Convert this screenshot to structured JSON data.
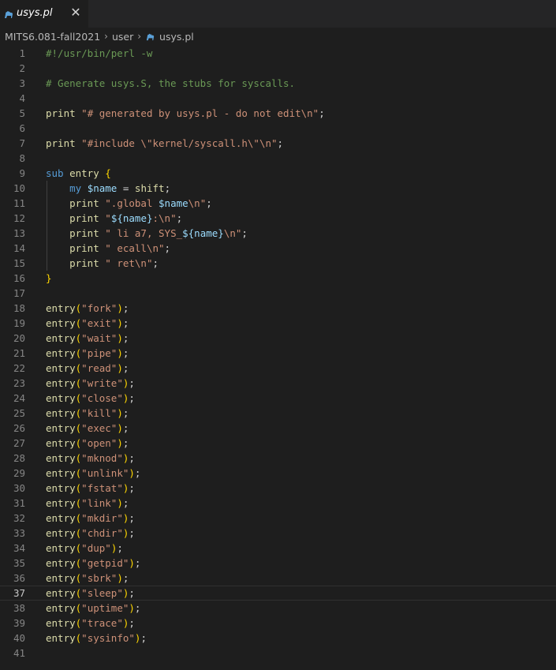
{
  "tab": {
    "title": "usys.pl",
    "close_glyph": "✕",
    "icon": "perl-camel-icon"
  },
  "breadcrumb": {
    "folder1": "MITS6.081-fall2021",
    "folder2": "user",
    "file": "usys.pl"
  },
  "editor": {
    "current_line": 37,
    "lines": [
      {
        "n": "1",
        "tokens": [
          {
            "t": "#!/usr/bin/perl -w",
            "c": "comment"
          }
        ]
      },
      {
        "n": "2",
        "tokens": []
      },
      {
        "n": "3",
        "tokens": [
          {
            "t": "# Generate usys.S, the stubs for syscalls.",
            "c": "comment"
          }
        ]
      },
      {
        "n": "4",
        "tokens": []
      },
      {
        "n": "5",
        "tokens": [
          {
            "t": "print",
            "c": "func"
          },
          {
            "t": " ",
            "c": "plain"
          },
          {
            "t": "\"# generated by usys.pl - do not edit\\n\"",
            "c": "string"
          },
          {
            "t": ";",
            "c": "plain"
          }
        ]
      },
      {
        "n": "6",
        "tokens": []
      },
      {
        "n": "7",
        "tokens": [
          {
            "t": "print",
            "c": "func"
          },
          {
            "t": " ",
            "c": "plain"
          },
          {
            "t": "\"#include \\\"kernel/syscall.h\\\"\\n\"",
            "c": "string"
          },
          {
            "t": ";",
            "c": "plain"
          }
        ]
      },
      {
        "n": "8",
        "tokens": []
      },
      {
        "n": "9",
        "tokens": [
          {
            "t": "sub",
            "c": "keyword"
          },
          {
            "t": " ",
            "c": "plain"
          },
          {
            "t": "entry",
            "c": "func"
          },
          {
            "t": " ",
            "c": "plain"
          },
          {
            "t": "{",
            "c": "brace"
          }
        ]
      },
      {
        "n": "10",
        "tokens": [
          {
            "t": "    ",
            "c": "plain"
          },
          {
            "t": "my",
            "c": "keyword"
          },
          {
            "t": " ",
            "c": "plain"
          },
          {
            "t": "$name",
            "c": "var"
          },
          {
            "t": " = ",
            "c": "plain"
          },
          {
            "t": "shift",
            "c": "func"
          },
          {
            "t": ";",
            "c": "plain"
          }
        ]
      },
      {
        "n": "11",
        "tokens": [
          {
            "t": "    ",
            "c": "plain"
          },
          {
            "t": "print",
            "c": "func"
          },
          {
            "t": " ",
            "c": "plain"
          },
          {
            "t": "\".global ",
            "c": "string"
          },
          {
            "t": "$name",
            "c": "var"
          },
          {
            "t": "\\n\"",
            "c": "string"
          },
          {
            "t": ";",
            "c": "plain"
          }
        ]
      },
      {
        "n": "12",
        "tokens": [
          {
            "t": "    ",
            "c": "plain"
          },
          {
            "t": "print",
            "c": "func"
          },
          {
            "t": " ",
            "c": "plain"
          },
          {
            "t": "\"",
            "c": "string"
          },
          {
            "t": "${name}",
            "c": "var"
          },
          {
            "t": ":\\n\"",
            "c": "string"
          },
          {
            "t": ";",
            "c": "plain"
          }
        ]
      },
      {
        "n": "13",
        "tokens": [
          {
            "t": "    ",
            "c": "plain"
          },
          {
            "t": "print",
            "c": "func"
          },
          {
            "t": " ",
            "c": "plain"
          },
          {
            "t": "\" li a7, SYS_",
            "c": "string"
          },
          {
            "t": "${name}",
            "c": "var"
          },
          {
            "t": "\\n\"",
            "c": "string"
          },
          {
            "t": ";",
            "c": "plain"
          }
        ]
      },
      {
        "n": "14",
        "tokens": [
          {
            "t": "    ",
            "c": "plain"
          },
          {
            "t": "print",
            "c": "func"
          },
          {
            "t": " ",
            "c": "plain"
          },
          {
            "t": "\" ecall\\n\"",
            "c": "string"
          },
          {
            "t": ";",
            "c": "plain"
          }
        ]
      },
      {
        "n": "15",
        "tokens": [
          {
            "t": "    ",
            "c": "plain"
          },
          {
            "t": "print",
            "c": "func"
          },
          {
            "t": " ",
            "c": "plain"
          },
          {
            "t": "\" ret\\n\"",
            "c": "string"
          },
          {
            "t": ";",
            "c": "plain"
          }
        ]
      },
      {
        "n": "16",
        "tokens": [
          {
            "t": "}",
            "c": "brace"
          }
        ]
      },
      {
        "n": "17",
        "tokens": []
      },
      {
        "n": "18",
        "tokens": [
          {
            "t": "entry",
            "c": "func"
          },
          {
            "t": "(",
            "c": "brace"
          },
          {
            "t": "\"fork\"",
            "c": "string"
          },
          {
            "t": ")",
            "c": "brace"
          },
          {
            "t": ";",
            "c": "plain"
          }
        ]
      },
      {
        "n": "19",
        "tokens": [
          {
            "t": "entry",
            "c": "func"
          },
          {
            "t": "(",
            "c": "brace"
          },
          {
            "t": "\"exit\"",
            "c": "string"
          },
          {
            "t": ")",
            "c": "brace"
          },
          {
            "t": ";",
            "c": "plain"
          }
        ]
      },
      {
        "n": "20",
        "tokens": [
          {
            "t": "entry",
            "c": "func"
          },
          {
            "t": "(",
            "c": "brace"
          },
          {
            "t": "\"wait\"",
            "c": "string"
          },
          {
            "t": ")",
            "c": "brace"
          },
          {
            "t": ";",
            "c": "plain"
          }
        ]
      },
      {
        "n": "21",
        "tokens": [
          {
            "t": "entry",
            "c": "func"
          },
          {
            "t": "(",
            "c": "brace"
          },
          {
            "t": "\"pipe\"",
            "c": "string"
          },
          {
            "t": ")",
            "c": "brace"
          },
          {
            "t": ";",
            "c": "plain"
          }
        ]
      },
      {
        "n": "22",
        "tokens": [
          {
            "t": "entry",
            "c": "func"
          },
          {
            "t": "(",
            "c": "brace"
          },
          {
            "t": "\"read\"",
            "c": "string"
          },
          {
            "t": ")",
            "c": "brace"
          },
          {
            "t": ";",
            "c": "plain"
          }
        ]
      },
      {
        "n": "23",
        "tokens": [
          {
            "t": "entry",
            "c": "func"
          },
          {
            "t": "(",
            "c": "brace"
          },
          {
            "t": "\"write\"",
            "c": "string"
          },
          {
            "t": ")",
            "c": "brace"
          },
          {
            "t": ";",
            "c": "plain"
          }
        ]
      },
      {
        "n": "24",
        "tokens": [
          {
            "t": "entry",
            "c": "func"
          },
          {
            "t": "(",
            "c": "brace"
          },
          {
            "t": "\"close\"",
            "c": "string"
          },
          {
            "t": ")",
            "c": "brace"
          },
          {
            "t": ";",
            "c": "plain"
          }
        ]
      },
      {
        "n": "25",
        "tokens": [
          {
            "t": "entry",
            "c": "func"
          },
          {
            "t": "(",
            "c": "brace"
          },
          {
            "t": "\"kill\"",
            "c": "string"
          },
          {
            "t": ")",
            "c": "brace"
          },
          {
            "t": ";",
            "c": "plain"
          }
        ]
      },
      {
        "n": "26",
        "tokens": [
          {
            "t": "entry",
            "c": "func"
          },
          {
            "t": "(",
            "c": "brace"
          },
          {
            "t": "\"exec\"",
            "c": "string"
          },
          {
            "t": ")",
            "c": "brace"
          },
          {
            "t": ";",
            "c": "plain"
          }
        ]
      },
      {
        "n": "27",
        "tokens": [
          {
            "t": "entry",
            "c": "func"
          },
          {
            "t": "(",
            "c": "brace"
          },
          {
            "t": "\"open\"",
            "c": "string"
          },
          {
            "t": ")",
            "c": "brace"
          },
          {
            "t": ";",
            "c": "plain"
          }
        ]
      },
      {
        "n": "28",
        "tokens": [
          {
            "t": "entry",
            "c": "func"
          },
          {
            "t": "(",
            "c": "brace"
          },
          {
            "t": "\"mknod\"",
            "c": "string"
          },
          {
            "t": ")",
            "c": "brace"
          },
          {
            "t": ";",
            "c": "plain"
          }
        ]
      },
      {
        "n": "29",
        "tokens": [
          {
            "t": "entry",
            "c": "func"
          },
          {
            "t": "(",
            "c": "brace"
          },
          {
            "t": "\"unlink\"",
            "c": "string"
          },
          {
            "t": ")",
            "c": "brace"
          },
          {
            "t": ";",
            "c": "plain"
          }
        ]
      },
      {
        "n": "30",
        "tokens": [
          {
            "t": "entry",
            "c": "func"
          },
          {
            "t": "(",
            "c": "brace"
          },
          {
            "t": "\"fstat\"",
            "c": "string"
          },
          {
            "t": ")",
            "c": "brace"
          },
          {
            "t": ";",
            "c": "plain"
          }
        ]
      },
      {
        "n": "31",
        "tokens": [
          {
            "t": "entry",
            "c": "func"
          },
          {
            "t": "(",
            "c": "brace"
          },
          {
            "t": "\"link\"",
            "c": "string"
          },
          {
            "t": ")",
            "c": "brace"
          },
          {
            "t": ";",
            "c": "plain"
          }
        ]
      },
      {
        "n": "32",
        "tokens": [
          {
            "t": "entry",
            "c": "func"
          },
          {
            "t": "(",
            "c": "brace"
          },
          {
            "t": "\"mkdir\"",
            "c": "string"
          },
          {
            "t": ")",
            "c": "brace"
          },
          {
            "t": ";",
            "c": "plain"
          }
        ]
      },
      {
        "n": "33",
        "tokens": [
          {
            "t": "entry",
            "c": "func"
          },
          {
            "t": "(",
            "c": "brace"
          },
          {
            "t": "\"chdir\"",
            "c": "string"
          },
          {
            "t": ")",
            "c": "brace"
          },
          {
            "t": ";",
            "c": "plain"
          }
        ]
      },
      {
        "n": "34",
        "tokens": [
          {
            "t": "entry",
            "c": "func"
          },
          {
            "t": "(",
            "c": "brace"
          },
          {
            "t": "\"dup\"",
            "c": "string"
          },
          {
            "t": ")",
            "c": "brace"
          },
          {
            "t": ";",
            "c": "plain"
          }
        ]
      },
      {
        "n": "35",
        "tokens": [
          {
            "t": "entry",
            "c": "func"
          },
          {
            "t": "(",
            "c": "brace"
          },
          {
            "t": "\"getpid\"",
            "c": "string"
          },
          {
            "t": ")",
            "c": "brace"
          },
          {
            "t": ";",
            "c": "plain"
          }
        ]
      },
      {
        "n": "36",
        "tokens": [
          {
            "t": "entry",
            "c": "func"
          },
          {
            "t": "(",
            "c": "brace"
          },
          {
            "t": "\"sbrk\"",
            "c": "string"
          },
          {
            "t": ")",
            "c": "brace"
          },
          {
            "t": ";",
            "c": "plain"
          }
        ]
      },
      {
        "n": "37",
        "tokens": [
          {
            "t": "entry",
            "c": "func"
          },
          {
            "t": "(",
            "c": "brace"
          },
          {
            "t": "\"sleep\"",
            "c": "string"
          },
          {
            "t": ")",
            "c": "brace"
          },
          {
            "t": ";",
            "c": "plain"
          }
        ]
      },
      {
        "n": "38",
        "tokens": [
          {
            "t": "entry",
            "c": "func"
          },
          {
            "t": "(",
            "c": "brace"
          },
          {
            "t": "\"uptime\"",
            "c": "string"
          },
          {
            "t": ")",
            "c": "brace"
          },
          {
            "t": ";",
            "c": "plain"
          }
        ]
      },
      {
        "n": "39",
        "tokens": [
          {
            "t": "entry",
            "c": "func"
          },
          {
            "t": "(",
            "c": "brace"
          },
          {
            "t": "\"trace\"",
            "c": "string"
          },
          {
            "t": ")",
            "c": "brace"
          },
          {
            "t": ";",
            "c": "plain"
          }
        ]
      },
      {
        "n": "40",
        "tokens": [
          {
            "t": "entry",
            "c": "func"
          },
          {
            "t": "(",
            "c": "brace"
          },
          {
            "t": "\"sysinfo\"",
            "c": "string"
          },
          {
            "t": ")",
            "c": "brace"
          },
          {
            "t": ";",
            "c": "plain"
          }
        ]
      },
      {
        "n": "41",
        "tokens": []
      }
    ]
  },
  "colors": {
    "background": "#1e1e1e",
    "tabbar": "#252526",
    "comment": "#6a9955",
    "string": "#ce9178",
    "func": "#dcdcaa",
    "keyword": "#569cd6",
    "var": "#9cdcfe",
    "brace": "#ffd700"
  }
}
